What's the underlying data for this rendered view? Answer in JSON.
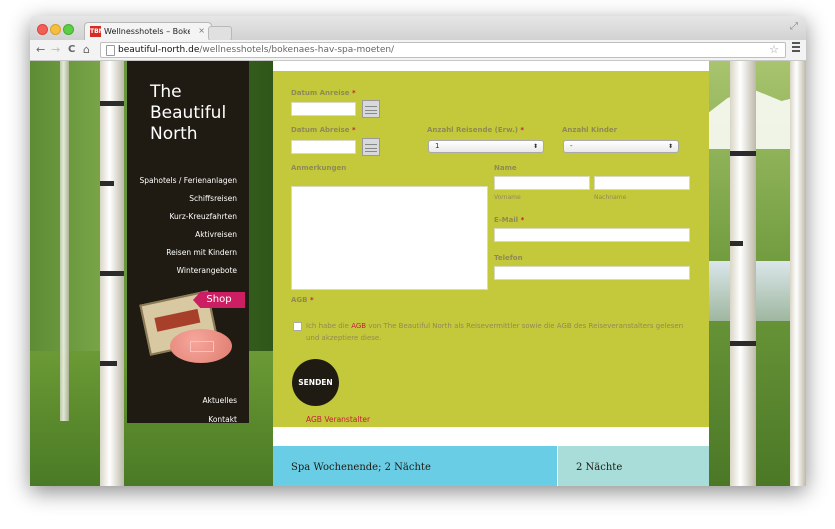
{
  "browser": {
    "tab_title": "Wellnesshotels – Bokenäs Ha",
    "tab_close": "×",
    "favicon_text": "TBN",
    "url_host": "beautiful-north.de",
    "url_path": "/wellnesshotels/bokenaes-hav-spa-moeten/",
    "back": "←",
    "forward": "→",
    "reload": "C",
    "home": "⌂",
    "star": "☆",
    "resize": "⤢"
  },
  "sidebar": {
    "logo_line1": "The",
    "logo_line2": "Beautiful",
    "logo_line3": "North",
    "nav": [
      "Spahotels / Ferienanlagen",
      "Schiffsreisen",
      "Kurz-Kreuzfahrten",
      "Aktivreisen",
      "Reisen mit Kindern",
      "Winterangebote"
    ],
    "shop_label": "Shop",
    "footer_nav": [
      "Aktuelles",
      "Kontakt"
    ]
  },
  "form": {
    "arrival_label": "Datum Anreise",
    "departure_label": "Datum Abreise",
    "travellers_label": "Anzahl Reisende (Erw.)",
    "travellers_value": "1",
    "children_label": "Anzahl Kinder",
    "children_value": "-",
    "remarks_label": "Anmerkungen",
    "name_label": "Name",
    "firstname_sub": "Vorname",
    "lastname_sub": "Nachname",
    "email_label": "E-Mail",
    "phone_label": "Telefon",
    "agb_label": "AGB",
    "agb_text_before": "Ich habe die ",
    "agb_link": "AGB",
    "agb_text_after": " von The Beautiful North als Reisevermittler sowie die AGB des Reiseveranstalters gelesen und akzeptiere diese.",
    "required_mark": "*",
    "submit": "SENDEN",
    "agb_operator_link": "AGB Veranstalter"
  },
  "offers": [
    {
      "title": "Spa Wochenende; 2 Nächte"
    },
    {
      "title": "2 Nächte"
    }
  ],
  "colors": {
    "form_bg": "#c4c93b",
    "sidebar_bg": "#1f1b12",
    "accent_red": "#c41e3a",
    "shop_pink": "#cc1f63",
    "offer_blue": "#69cde6",
    "offer_teal": "#a8ddd9"
  }
}
